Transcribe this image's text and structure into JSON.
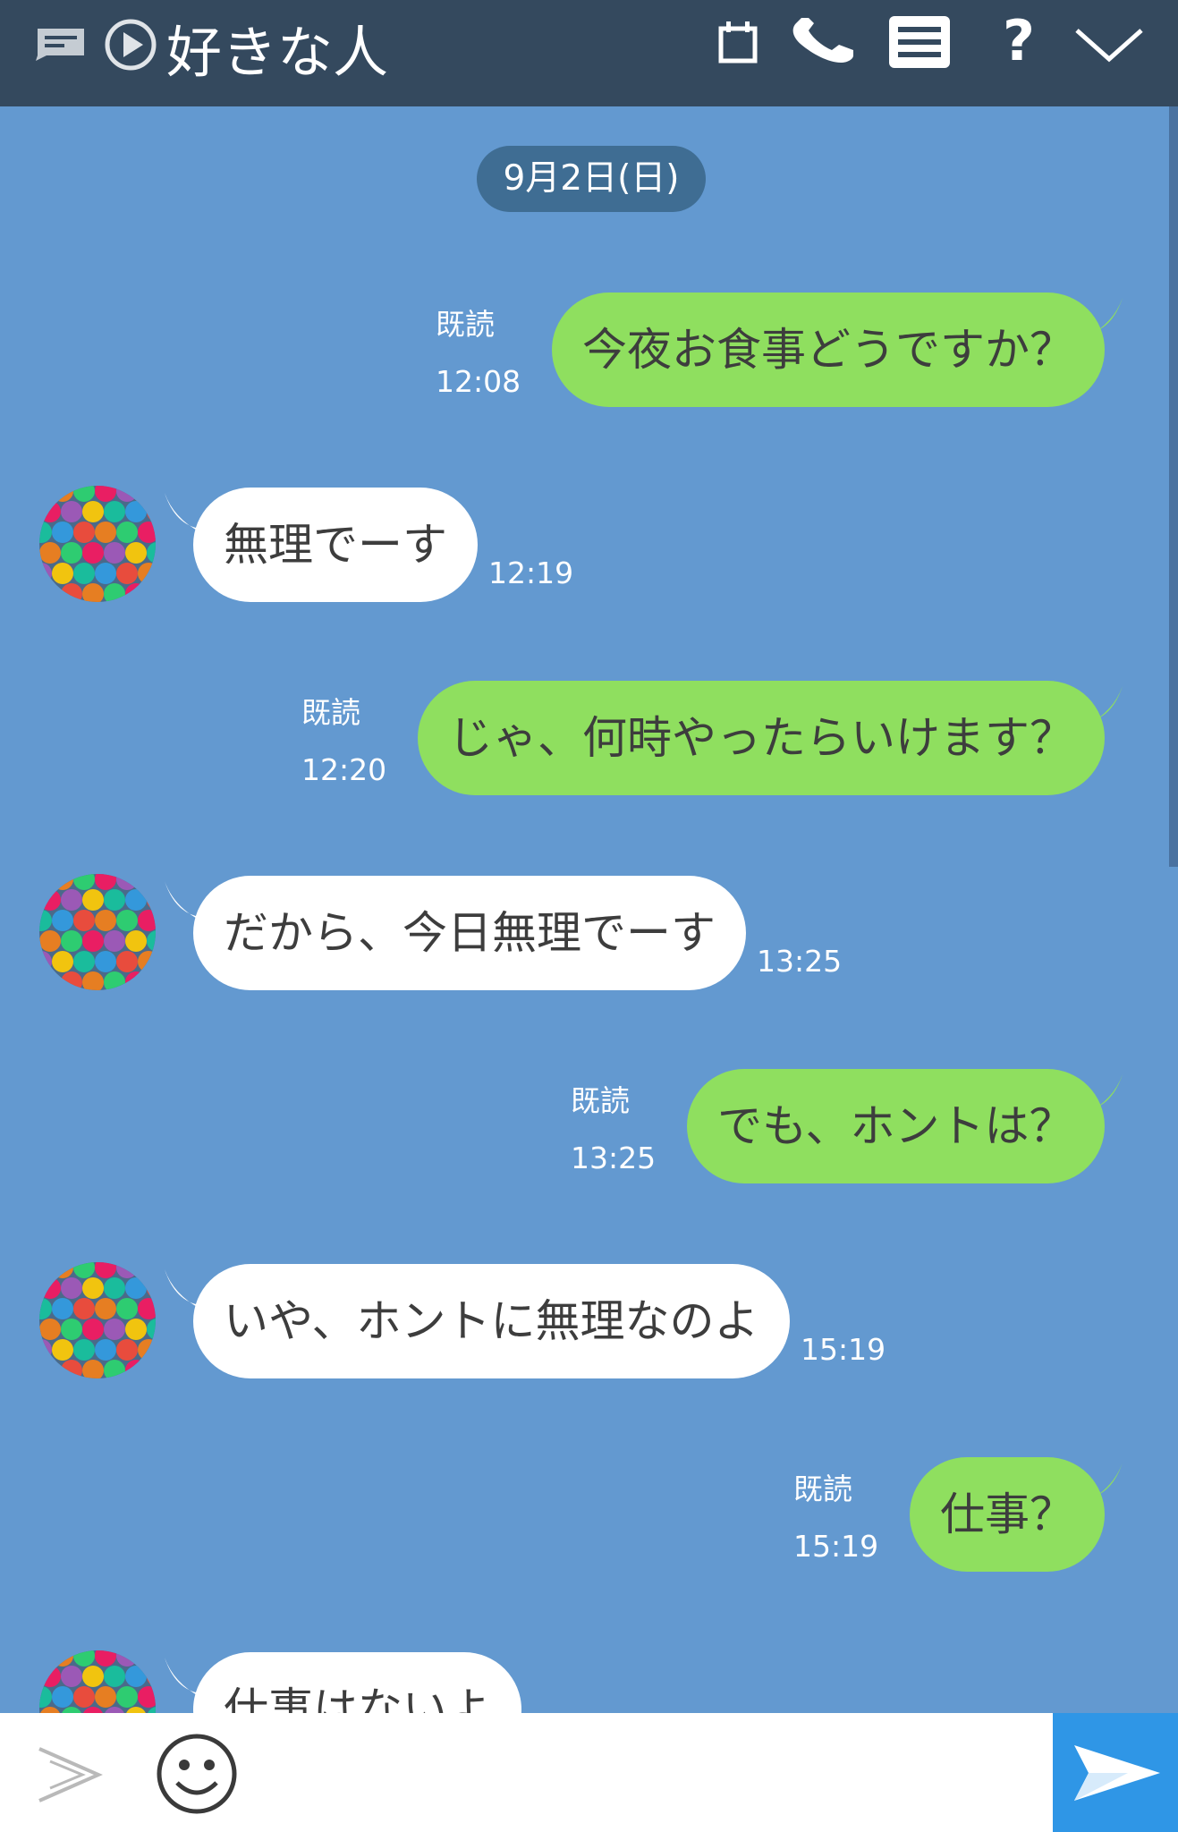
{
  "header": {
    "title": "好きな人",
    "icons": [
      "keep-memo-icon",
      "play-icon",
      "calendar-icon",
      "phone-icon",
      "menu-icon",
      "help-icon",
      "chevron-down-icon"
    ]
  },
  "chat": {
    "date": "9月2日(日)",
    "read_label": "既読",
    "messages": [
      {
        "dir": "out",
        "text": "今夜お食事どうですか？",
        "time": "12:08",
        "read": "既読"
      },
      {
        "dir": "in",
        "text": "無理でーす",
        "time": "12:19"
      },
      {
        "dir": "out",
        "text": "じゃ、何時やったらいけます？",
        "time": "12:20",
        "read": "既読"
      },
      {
        "dir": "in",
        "text": "だから、今日無理でーす",
        "time": "13:25"
      },
      {
        "dir": "out",
        "text": "でも、ホントは？",
        "time": "13:25",
        "read": "既読"
      },
      {
        "dir": "in",
        "text": "いや、ホントに無理なのよ",
        "time": "15:19"
      },
      {
        "dir": "out",
        "text": "仕事？",
        "time": "15:19",
        "read": "既読"
      },
      {
        "dir": "in",
        "text": "仕事はないよ",
        "time": ""
      }
    ]
  },
  "input": {
    "placeholder": "",
    "icons": [
      "expand-arrow-icon",
      "emoji-icon",
      "send-icon"
    ]
  },
  "colors": {
    "header_bg": "#34495e",
    "chat_bg": "#6399d0",
    "outgoing_bubble": "#8fdf5f",
    "incoming_bubble": "#ffffff",
    "date_pill": "#3f6d93",
    "send_button": "#2f96e6"
  }
}
